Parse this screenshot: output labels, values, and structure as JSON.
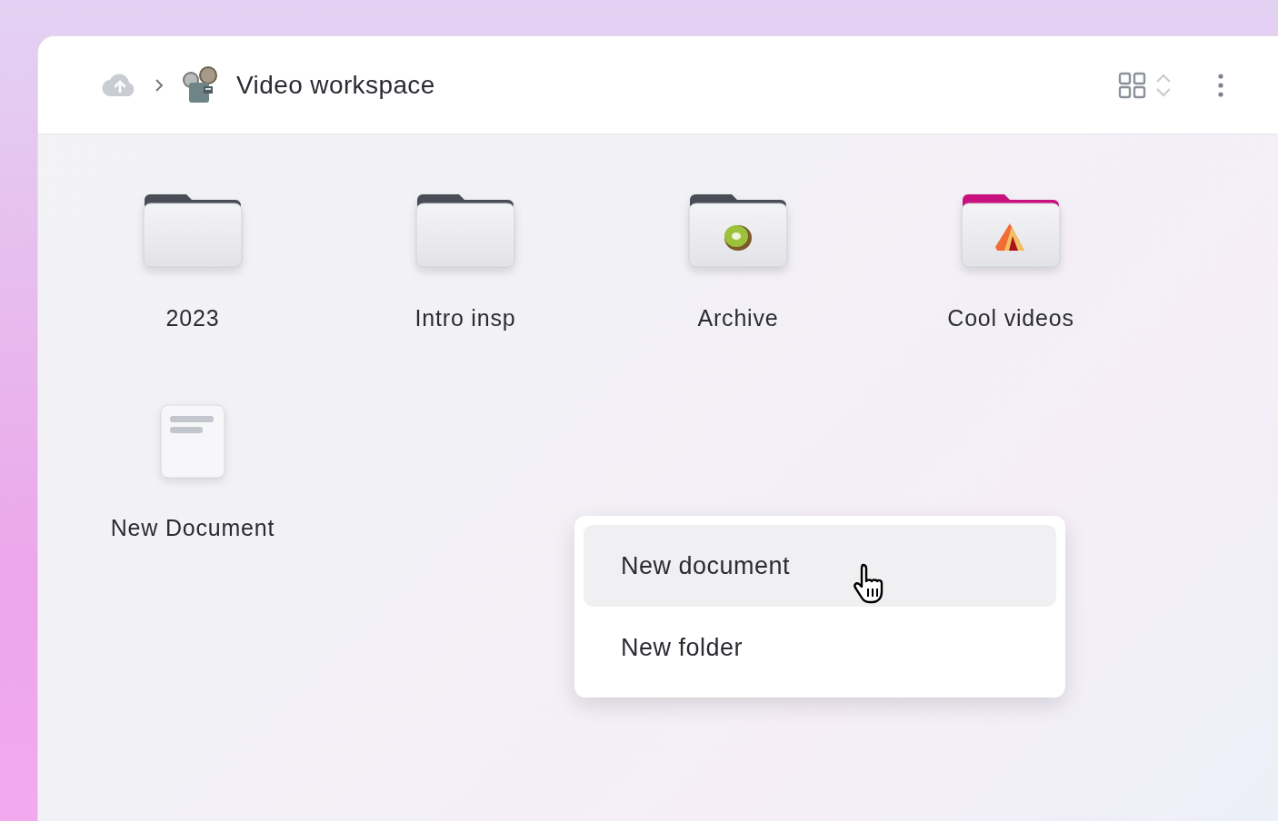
{
  "breadcrumb": {
    "title": "Video workspace"
  },
  "items": [
    {
      "kind": "folder",
      "label": "2023",
      "color": "#4a4d55"
    },
    {
      "kind": "folder",
      "label": "Intro insp",
      "color": "#4a4d55"
    },
    {
      "kind": "kiwi",
      "label": "Archive",
      "color": "#4a4d55"
    },
    {
      "kind": "tent",
      "label": "Cool videos",
      "color": "#c8117f"
    },
    {
      "kind": "document",
      "label": "New Document"
    }
  ],
  "context_menu": [
    {
      "label": "New document",
      "selected": true
    },
    {
      "label": "New folder",
      "selected": false
    }
  ]
}
